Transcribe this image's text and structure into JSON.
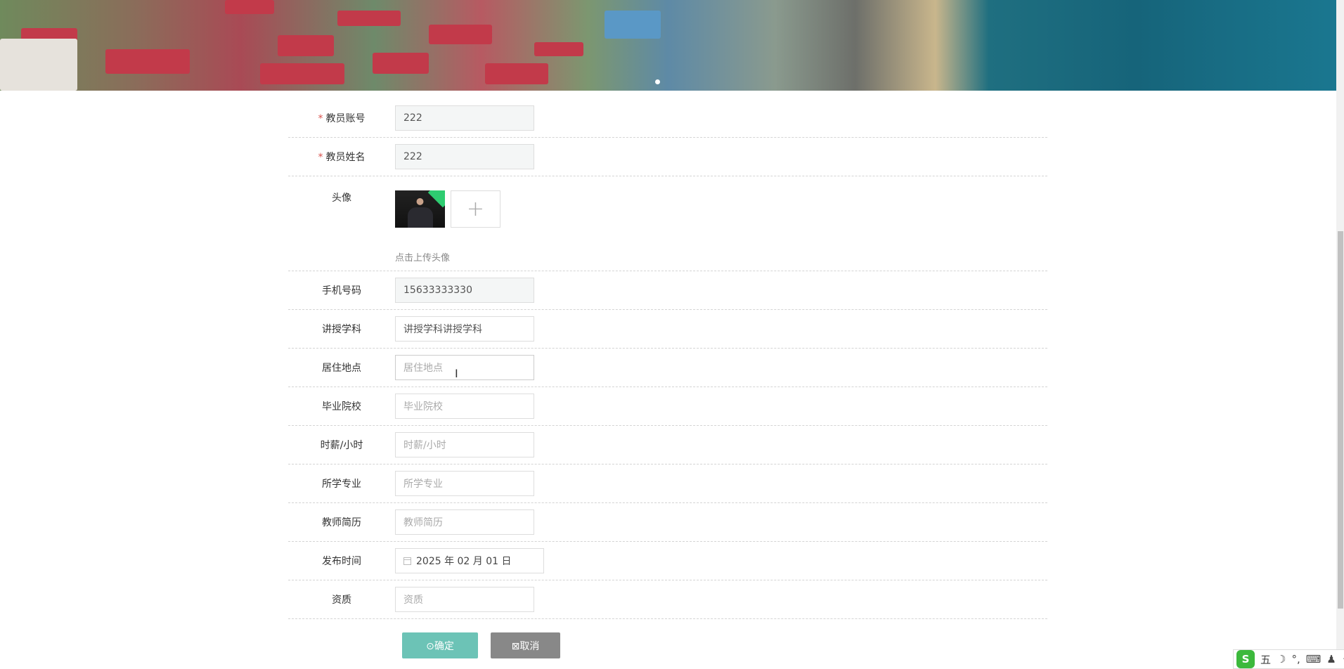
{
  "form": {
    "account": {
      "label": "教员账号",
      "value": "222",
      "required": true
    },
    "name": {
      "label": "教员姓名",
      "value": "222",
      "required": true
    },
    "avatar": {
      "label": "头像",
      "hint": "点击上传头像",
      "add_icon": "+"
    },
    "phone": {
      "label": "手机号码",
      "value": "15633333330"
    },
    "subject": {
      "label": "讲授学科",
      "value": "讲授学科讲授学科"
    },
    "address": {
      "label": "居住地点",
      "placeholder": "居住地点"
    },
    "school": {
      "label": "毕业院校",
      "placeholder": "毕业院校"
    },
    "wage": {
      "label": "时薪/小时",
      "placeholder": "时薪/小时"
    },
    "major": {
      "label": "所学专业",
      "placeholder": "所学专业"
    },
    "resume": {
      "label": "教师简历",
      "placeholder": "教师简历"
    },
    "publish": {
      "label": "发布时间",
      "value": "2025 年 02 月 01 日"
    },
    "qualification": {
      "label": "资质",
      "placeholder": "资质"
    }
  },
  "buttons": {
    "confirm": "⊙确定",
    "cancel": "⊠取消"
  },
  "ime": {
    "logo": "S",
    "mode": "五",
    "items": [
      "☽",
      "°,",
      "⌨",
      "♟",
      "⁘"
    ]
  },
  "colors": {
    "confirm": "#6cc3b6",
    "cancel": "#888888",
    "required": "#d9534f"
  }
}
